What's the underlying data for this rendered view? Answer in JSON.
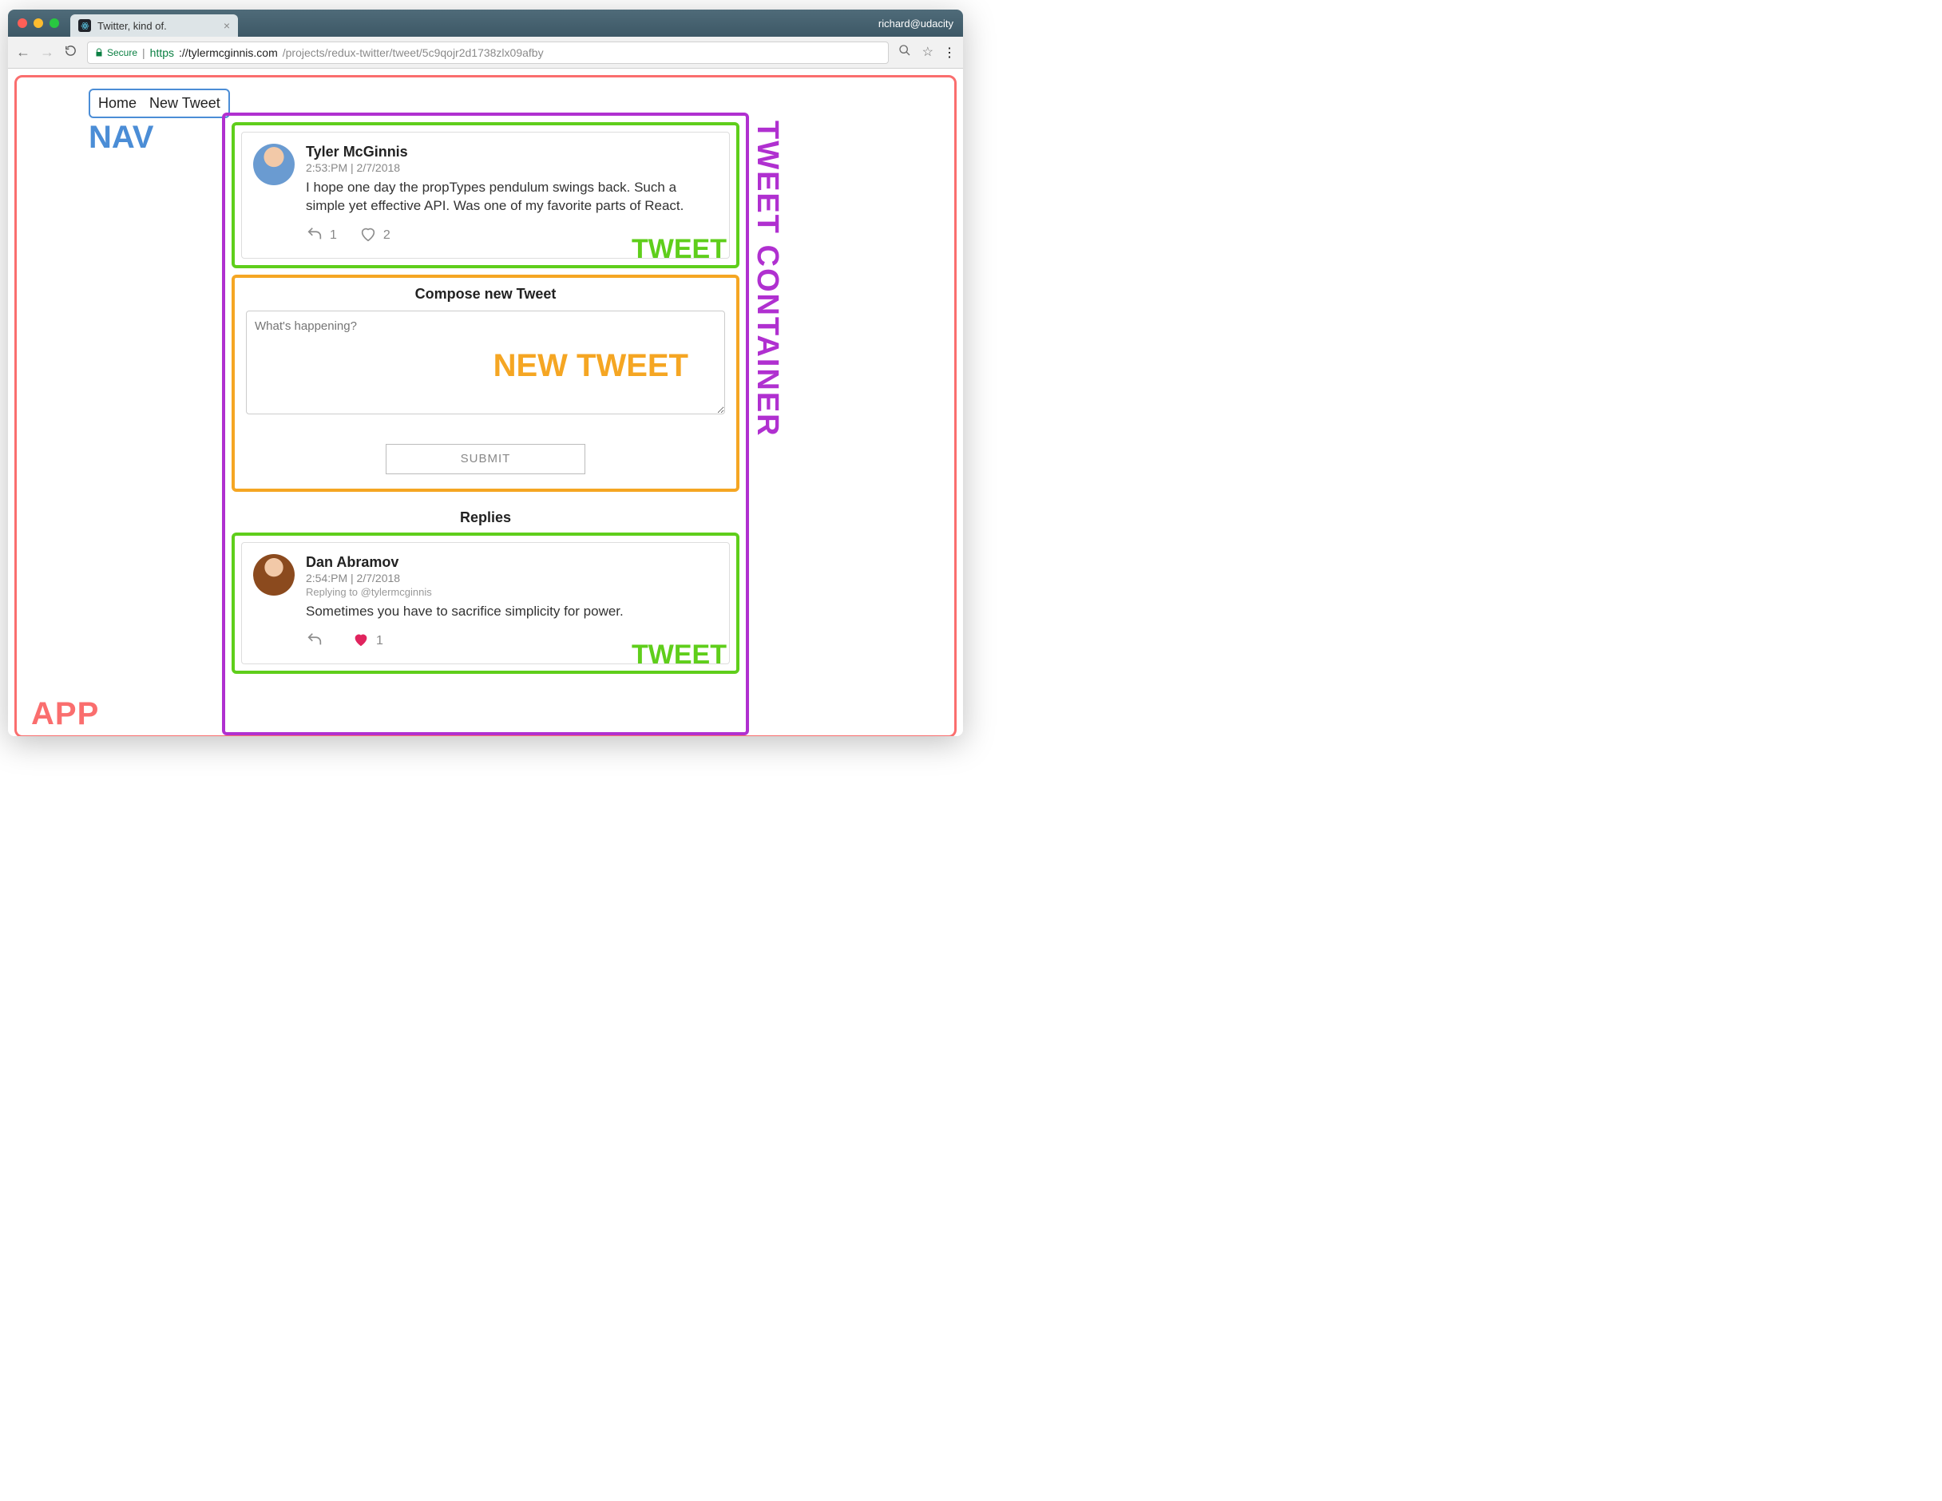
{
  "browser": {
    "tab_title": "Twitter, kind of.",
    "user_label": "richard@udacity",
    "secure_label": "Secure",
    "url_scheme": "https",
    "url_host": "://tylermcginnis.com",
    "url_path": "/projects/redux-twitter/tweet/5c9qojr2d1738zlx09afby"
  },
  "annotations": {
    "app": "APP",
    "nav": "NAV",
    "container": "TWEET CONTAINER",
    "tweet": "TWEET",
    "newtweet": "NEW TWEET"
  },
  "nav": {
    "home": "Home",
    "new_tweet": "New Tweet"
  },
  "main_tweet": {
    "author": "Tyler McGinnis",
    "timestamp": "2:53:PM | 2/7/2018",
    "text": "I hope one day the propTypes pendulum swings back. Such a simple yet effective API. Was one of my favorite parts of React.",
    "reply_count": "1",
    "like_count": "2",
    "liked": false,
    "avatar_bg": "#c9ddee"
  },
  "compose": {
    "title": "Compose new Tweet",
    "placeholder": "What's happening?",
    "submit": "SUBMIT"
  },
  "replies": {
    "title": "Replies",
    "items": [
      {
        "author": "Dan Abramov",
        "timestamp": "2:54:PM | 2/7/2018",
        "replying_to": "Replying to @tylermcginnis",
        "text": "Sometimes you have to sacrifice simplicity for power.",
        "reply_count": "",
        "like_count": "1",
        "liked": true,
        "avatar_bg": "#e08b3d"
      }
    ]
  }
}
